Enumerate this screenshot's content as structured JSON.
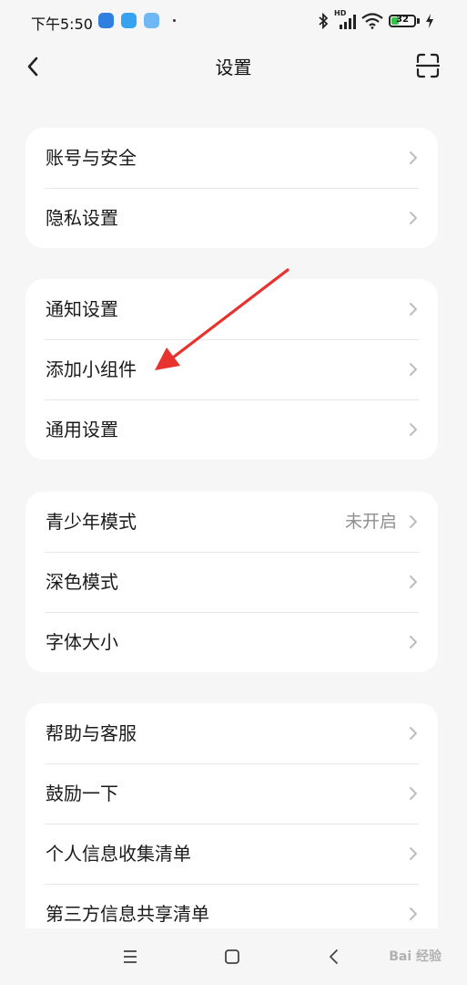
{
  "status_bar": {
    "time": "下午5:50",
    "network_label": "HD",
    "battery": "32"
  },
  "header": {
    "title": "设置"
  },
  "groups": [
    {
      "items": [
        {
          "label": "账号与安全"
        },
        {
          "label": "隐私设置"
        }
      ]
    },
    {
      "items": [
        {
          "label": "通知设置"
        },
        {
          "label": "添加小组件"
        },
        {
          "label": "通用设置"
        }
      ]
    },
    {
      "items": [
        {
          "label": "青少年模式",
          "value": "未开启"
        },
        {
          "label": "深色模式"
        },
        {
          "label": "字体大小"
        }
      ]
    },
    {
      "items": [
        {
          "label": "帮助与客服"
        },
        {
          "label": "鼓励一下"
        },
        {
          "label": "个人信息收集清单"
        },
        {
          "label": "第三方信息共享清单"
        }
      ]
    }
  ],
  "watermark": "Bai 经验",
  "colors": {
    "background": "#f6f6f6",
    "card": "#ffffff",
    "annotation_arrow": "#e8322e",
    "battery_fill": "#35c14a"
  },
  "icons": [
    "bluetooth-icon",
    "signal-icon",
    "wifi-icon",
    "battery-icon",
    "charging-icon",
    "back-icon",
    "scan-icon",
    "chevron-right-icon",
    "menu-icon",
    "home-icon",
    "back-nav-icon"
  ]
}
